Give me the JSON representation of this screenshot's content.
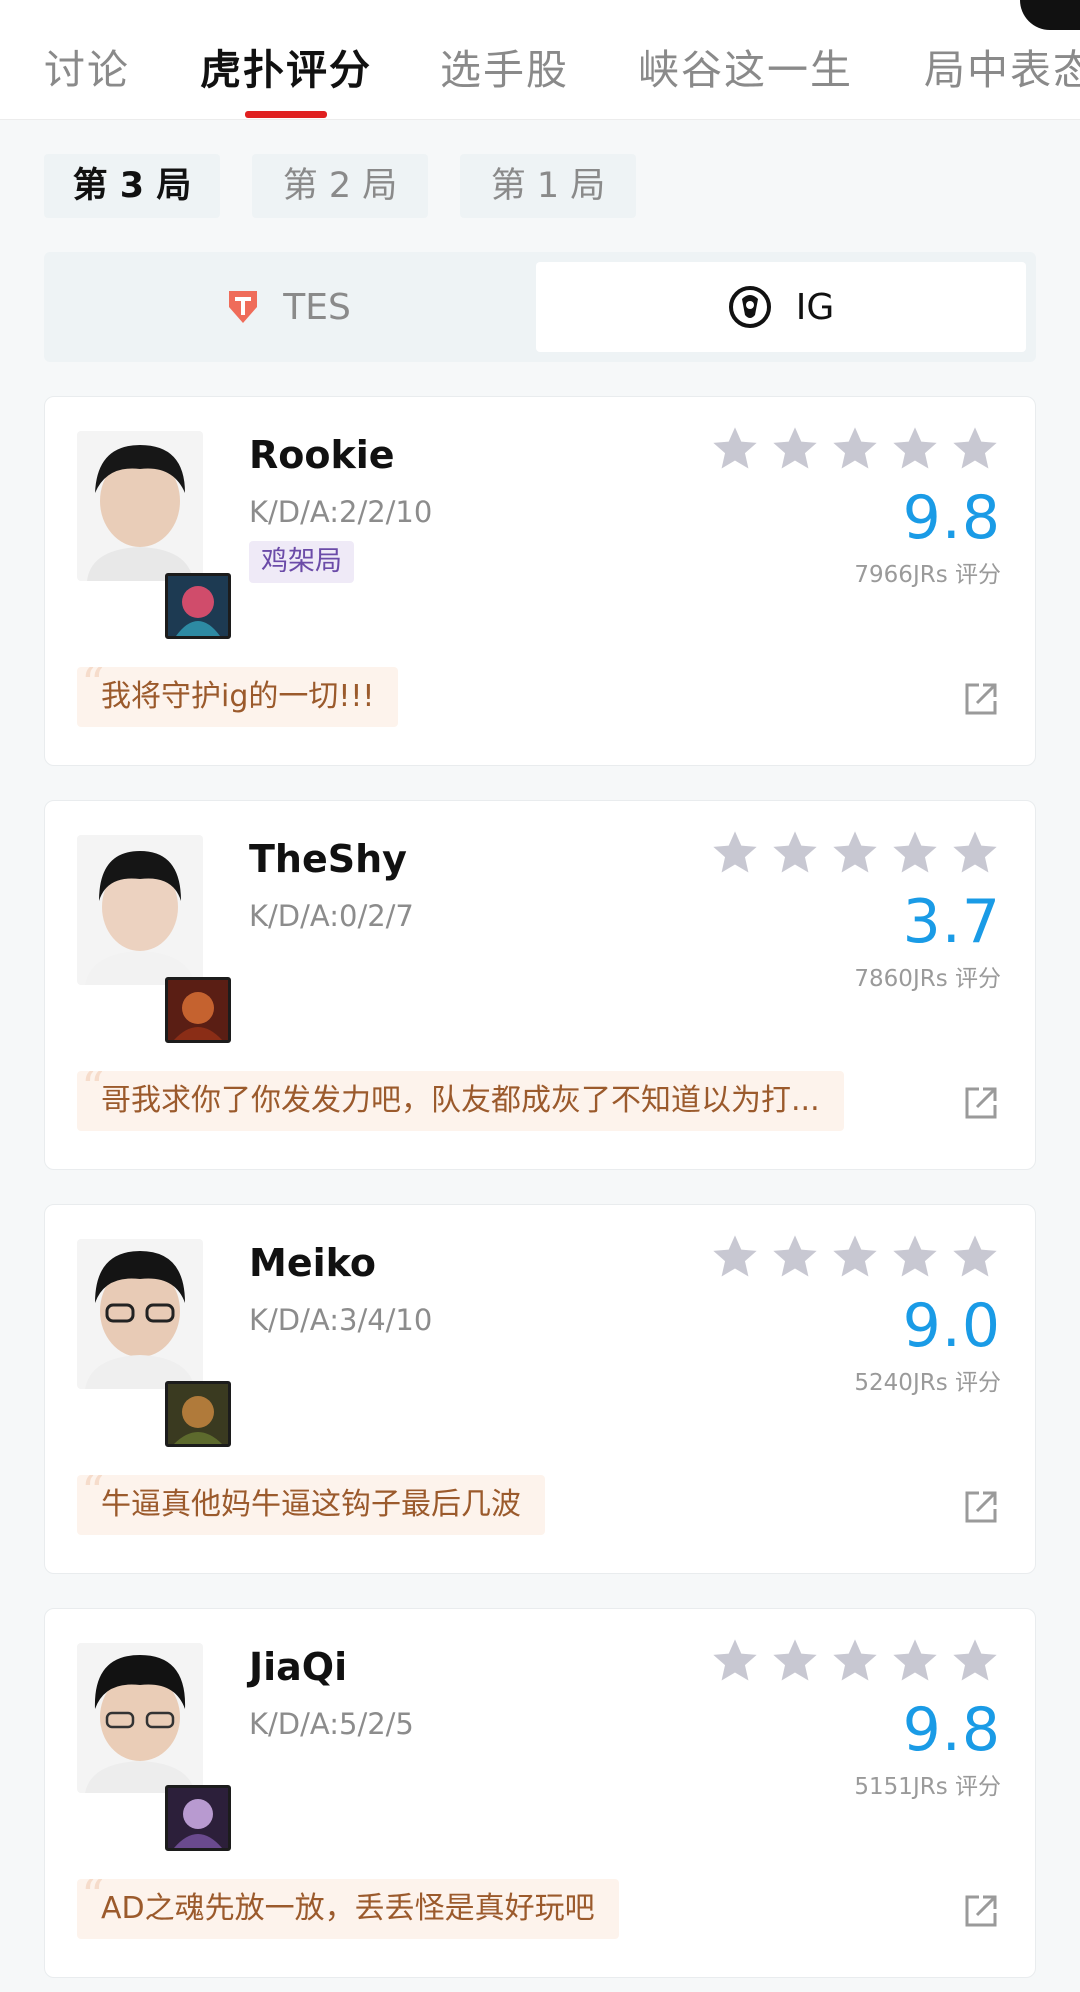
{
  "top_tabs": [
    {
      "label": "讨论"
    },
    {
      "label": "虎扑评分"
    },
    {
      "label": "选手股"
    },
    {
      "label": "峡谷这一生"
    },
    {
      "label": "局中表态"
    }
  ],
  "game_tabs": [
    {
      "label": "第 3 局"
    },
    {
      "label": "第 2 局"
    },
    {
      "label": "第 1 局"
    }
  ],
  "teams": [
    {
      "label": "TES",
      "icon": "tes-logo-icon"
    },
    {
      "label": "IG",
      "icon": "ig-logo-icon"
    }
  ],
  "colors": {
    "accent_red": "#e02020",
    "score_blue": "#1a9be6",
    "star_gray": "#c8c8d2"
  },
  "players": [
    {
      "name": "Rookie",
      "kda": "K/D/A:2/2/10",
      "tag": "鸡架局",
      "score": "9.8",
      "votes": "7966JRs 评分",
      "comment": "我将守护ig的一切!!!"
    },
    {
      "name": "TheShy",
      "kda": "K/D/A:0/2/7",
      "score": "3.7",
      "votes": "7860JRs 评分",
      "comment": "哥我求你了你发发力吧，队友都成灰了不知道以为打..."
    },
    {
      "name": "Meiko",
      "kda": "K/D/A:3/4/10",
      "score": "9.0",
      "votes": "5240JRs 评分",
      "comment": "牛逼真他妈牛逼这钩子最后几波"
    },
    {
      "name": "JiaQi",
      "kda": "K/D/A:5/2/5",
      "score": "9.8",
      "votes": "5151JRs 评分",
      "comment": "AD之魂先放一放，丢丢怪是真好玩吧"
    }
  ]
}
